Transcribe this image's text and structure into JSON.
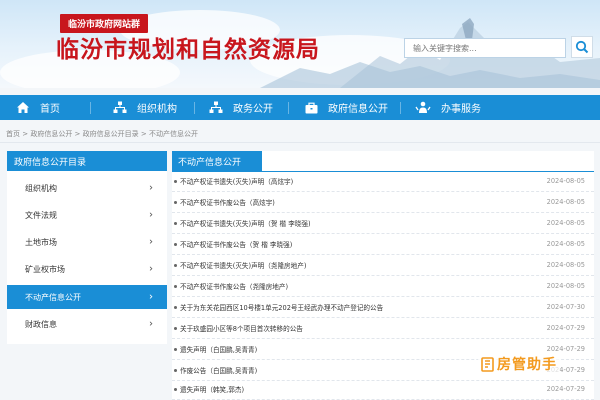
{
  "header": {
    "site_tag": "临汾市政府网站群",
    "title": "临汾市规划和自然资源局",
    "search_placeholder": "输入关键字搜索..."
  },
  "nav": {
    "items": [
      {
        "label": "首页",
        "icon": "home-icon"
      },
      {
        "label": "组织机构",
        "icon": "org-chart-icon"
      },
      {
        "label": "政务公开",
        "icon": "network-icon"
      },
      {
        "label": "政府信息公开",
        "icon": "briefcase-icon"
      },
      {
        "label": "办事服务",
        "icon": "people-icon"
      }
    ]
  },
  "breadcrumb": "首页 > 政府信息公开 > 政府信息公开目录 > 不动产信息公开",
  "sidebar": {
    "title": "政府信息公开目录",
    "items": [
      {
        "label": "组织机构",
        "active": false
      },
      {
        "label": "文件法规",
        "active": false
      },
      {
        "label": "土地市场",
        "active": false
      },
      {
        "label": "矿业权市场",
        "active": false
      },
      {
        "label": "不动产信息公开",
        "active": true
      },
      {
        "label": "财政信息",
        "active": false
      }
    ]
  },
  "main": {
    "tab_title": "不动产信息公开",
    "rows": [
      {
        "title": "不动产权证书遗失(灭失)声明（高炫宇)",
        "date": "2024-08-05"
      },
      {
        "title": "不动产权证书作废公告（高炫宇)",
        "date": "2024-08-05"
      },
      {
        "title": "不动产权证书遗失(灭失)声明（贺 楷 李晓强)",
        "date": "2024-08-05"
      },
      {
        "title": "不动产权证书作废公告（贺 楷 李晓强)",
        "date": "2024-08-05"
      },
      {
        "title": "不动产权证书遗失(灭失)声明（尧隆房地产)",
        "date": "2024-08-05"
      },
      {
        "title": "不动产权证书作废公告（尧隆房地产)",
        "date": "2024-08-05"
      },
      {
        "title": "关于为东关花园西区10号楼1单元202号王经武办理不动产登记的公告",
        "date": "2024-07-30"
      },
      {
        "title": "关于玖盛园小区等8个项目首次转移的公告",
        "date": "2024-07-29"
      },
      {
        "title": "遗失声明（白国鹏,吴青青)",
        "date": "2024-07-29"
      },
      {
        "title": "作废公告（白国鹏,吴青青)",
        "date": "2024-07-29"
      },
      {
        "title": "遗失声明（韩笑,郭杰)",
        "date": "2024-07-29"
      }
    ]
  },
  "watermark": {
    "text": "房管助手"
  },
  "colors": {
    "brand_blue": "#1a8ed6",
    "title_red": "#c8161d",
    "watermark_orange": "#f39a1e"
  }
}
